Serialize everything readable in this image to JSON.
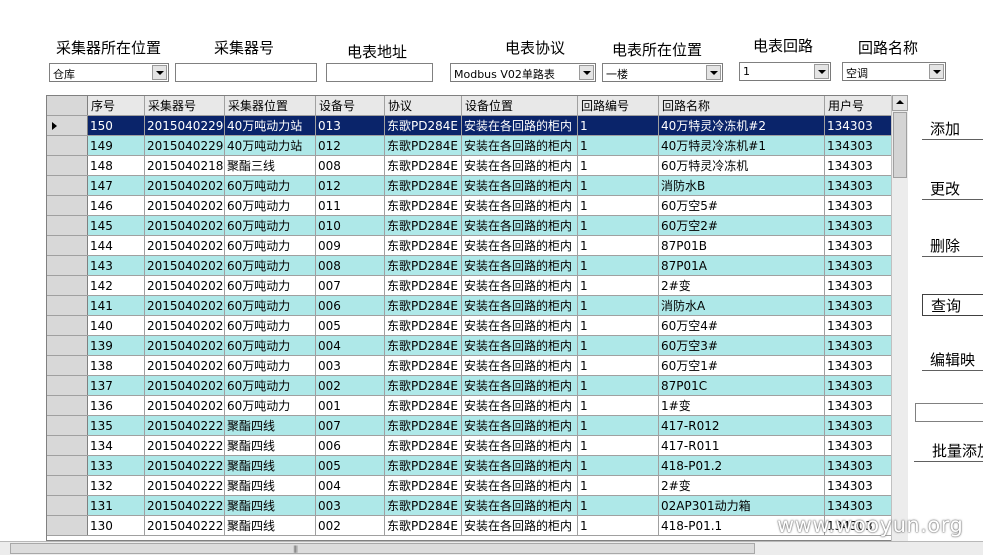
{
  "filters": {
    "collector_location": {
      "label": "采集器所在位置",
      "value": "仓库"
    },
    "collector_no": {
      "label": "采集器号",
      "value": ""
    },
    "meter_address": {
      "label": "电表地址",
      "value": ""
    },
    "meter_protocol": {
      "label": "电表协议",
      "value": "Modbus V02单路表"
    },
    "meter_location": {
      "label": "电表所在位置",
      "value": "一楼"
    },
    "meter_circuit": {
      "label": "电表回路",
      "value": "1"
    },
    "circuit_name": {
      "label": "回路名称",
      "value": "空调"
    }
  },
  "table": {
    "columns": [
      "序号",
      "采集器号",
      "采集器位置",
      "设备号",
      "协议",
      "设备位置",
      "回路编号",
      "回路名称",
      "用户号"
    ],
    "rows": [
      [
        "150",
        "2015040229",
        "40万吨动力站",
        "013",
        "东歌PD284E",
        "安装在各回路的柜内",
        "1",
        "40万特灵冷冻机#2",
        "134303"
      ],
      [
        "149",
        "2015040229",
        "40万吨动力站",
        "012",
        "东歌PD284E",
        "安装在各回路的柜内",
        "1",
        "40万特灵冷冻机#1",
        "134303"
      ],
      [
        "148",
        "2015040218",
        "聚酯三线",
        "008",
        "东歌PD284E",
        "安装在各回路的柜内",
        "1",
        "60万特灵冷冻机",
        "134303"
      ],
      [
        "147",
        "2015040202",
        "60万吨动力",
        "012",
        "东歌PD284E",
        "安装在各回路的柜内",
        "1",
        "消防水B",
        "134303"
      ],
      [
        "146",
        "2015040202",
        "60万吨动力",
        "011",
        "东歌PD284E",
        "安装在各回路的柜内",
        "1",
        "60万空5#",
        "134303"
      ],
      [
        "145",
        "2015040202",
        "60万吨动力",
        "010",
        "东歌PD284E",
        "安装在各回路的柜内",
        "1",
        "60万空2#",
        "134303"
      ],
      [
        "144",
        "2015040202",
        "60万吨动力",
        "009",
        "东歌PD284E",
        "安装在各回路的柜内",
        "1",
        "87P01B",
        "134303"
      ],
      [
        "143",
        "2015040202",
        "60万吨动力",
        "008",
        "东歌PD284E",
        "安装在各回路的柜内",
        "1",
        "87P01A",
        "134303"
      ],
      [
        "142",
        "2015040202",
        "60万吨动力",
        "007",
        "东歌PD284E",
        "安装在各回路的柜内",
        "1",
        "2#变",
        "134303"
      ],
      [
        "141",
        "2015040202",
        "60万吨动力",
        "006",
        "东歌PD284E",
        "安装在各回路的柜内",
        "1",
        "消防水A",
        "134303"
      ],
      [
        "140",
        "2015040202",
        "60万吨动力",
        "005",
        "东歌PD284E",
        "安装在各回路的柜内",
        "1",
        "60万空4#",
        "134303"
      ],
      [
        "139",
        "2015040202",
        "60万吨动力",
        "004",
        "东歌PD284E",
        "安装在各回路的柜内",
        "1",
        "60万空3#",
        "134303"
      ],
      [
        "138",
        "2015040202",
        "60万吨动力",
        "003",
        "东歌PD284E",
        "安装在各回路的柜内",
        "1",
        "60万空1#",
        "134303"
      ],
      [
        "137",
        "2015040202",
        "60万吨动力",
        "002",
        "东歌PD284E",
        "安装在各回路的柜内",
        "1",
        "87P01C",
        "134303"
      ],
      [
        "136",
        "2015040202",
        "60万吨动力",
        "001",
        "东歌PD284E",
        "安装在各回路的柜内",
        "1",
        "1#变",
        "134303"
      ],
      [
        "135",
        "2015040222",
        "聚酯四线",
        "007",
        "东歌PD284E",
        "安装在各回路的柜内",
        "1",
        "417-R012",
        "134303"
      ],
      [
        "134",
        "2015040222",
        "聚酯四线",
        "006",
        "东歌PD284E",
        "安装在各回路的柜内",
        "1",
        "417-R011",
        "134303"
      ],
      [
        "133",
        "2015040222",
        "聚酯四线",
        "005",
        "东歌PD284E",
        "安装在各回路的柜内",
        "1",
        "418-P01.2",
        "134303"
      ],
      [
        "132",
        "2015040222",
        "聚酯四线",
        "004",
        "东歌PD284E",
        "安装在各回路的柜内",
        "1",
        "2#变",
        "134303"
      ],
      [
        "131",
        "2015040222",
        "聚酯四线",
        "003",
        "东歌PD284E",
        "安装在各回路的柜内",
        "1",
        "02AP301动力箱",
        "134303"
      ],
      [
        "130",
        "2015040222",
        "聚酯四线",
        "002",
        "东歌PD284E",
        "安装在各回路的柜内",
        "1",
        "418-P01.1",
        "134303"
      ]
    ],
    "selected_row": 0,
    "row_colors": {
      "alt": "#aee8e8",
      "selected": "#0a246a"
    }
  },
  "buttons": {
    "add": "添加",
    "modify": "更改",
    "delete": "删除",
    "query": "查询",
    "edit_map": "编辑映",
    "batch_add": "批量添加"
  },
  "batch_input": "",
  "watermark": "www.wooyun.org"
}
